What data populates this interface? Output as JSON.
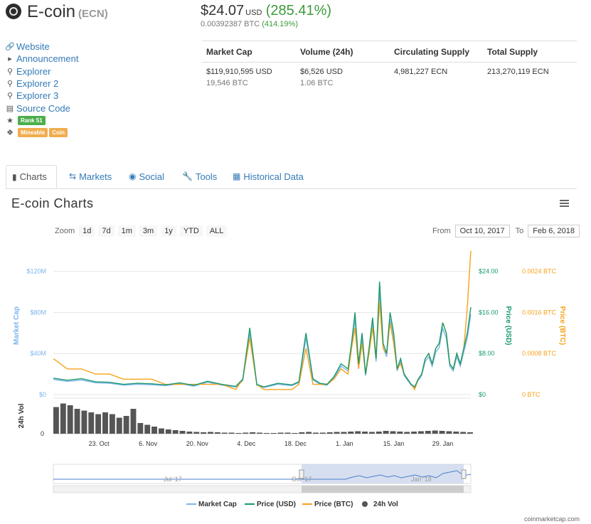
{
  "coin": {
    "name": "E-coin",
    "symbol": "(ECN)"
  },
  "price": {
    "usd": "$24.07",
    "unit": "USD",
    "usd_change": "(285.41%)",
    "btc": "0.00392387 BTC",
    "btc_change": "(414.19%)"
  },
  "links": [
    {
      "icon": "link-icon",
      "label": "Website"
    },
    {
      "icon": "bullhorn-icon",
      "label": "Announcement"
    },
    {
      "icon": "search-icon",
      "label": "Explorer"
    },
    {
      "icon": "search-icon",
      "label": "Explorer 2"
    },
    {
      "icon": "search-icon",
      "label": "Explorer 3"
    },
    {
      "icon": "hdd-icon",
      "label": "Source Code"
    }
  ],
  "rank": {
    "icon": "star-icon",
    "label": "Rank 51"
  },
  "tags": {
    "icon": "tags-icon",
    "items": [
      "Mineable",
      "Coin"
    ]
  },
  "stats": {
    "headers": [
      "Market Cap",
      "Volume (24h)",
      "Circulating Supply",
      "Total Supply"
    ],
    "row1": [
      "$119,910,595 USD",
      "$6,526 USD",
      "4,981,227 ECN",
      "213,270,119 ECN"
    ],
    "row2": [
      "19,546 BTC",
      "1.06 BTC",
      "",
      ""
    ]
  },
  "tabs": [
    {
      "icon": "bar-chart-icon",
      "label": "Charts"
    },
    {
      "icon": "exchange-icon",
      "label": "Markets"
    },
    {
      "icon": "globe-icon",
      "label": "Social"
    },
    {
      "icon": "wrench-icon",
      "label": "Tools"
    },
    {
      "icon": "calendar-icon",
      "label": "Historical Data"
    }
  ],
  "chart_header": {
    "title": "E-coin Charts"
  },
  "zoom": {
    "label": "Zoom",
    "buttons": [
      "1d",
      "7d",
      "1m",
      "3m",
      "1y",
      "YTD",
      "ALL"
    ]
  },
  "range": {
    "from_label": "From",
    "from": "Oct 10, 2017",
    "to_label": "To",
    "to": "Feb 6, 2018"
  },
  "credit": "coinmarketcap.com",
  "colors": {
    "market_cap": "#7cb5ec",
    "price_usd": "#1a9a6c",
    "price_btc": "#f7a21b",
    "volume": "#555555",
    "link": "#337ab7"
  },
  "chart_data": {
    "type": "line",
    "xlabels": [
      "23. Oct",
      "6. Nov",
      "20. Nov",
      "4. Dec",
      "18. Dec",
      "1. Jan",
      "15. Jan",
      "29. Jan"
    ],
    "axes": {
      "market_cap": {
        "label": "Market Cap",
        "ticks": [
          "$0",
          "$40M",
          "$80M",
          "$120M"
        ]
      },
      "price_usd": {
        "label": "Price (USD)",
        "ticks": [
          "$0",
          "$8.00",
          "$16.00",
          "$24.00"
        ]
      },
      "price_btc": {
        "label": "Price (BTC)",
        "ticks": [
          "0 BTC",
          "0.0008 BTC",
          "0.0016 BTC",
          "0.0024 BTC"
        ]
      },
      "volume": {
        "label": "24h Vol",
        "ticks": [
          "0"
        ]
      }
    },
    "navigator_labels": [
      "Jul '17",
      "Oct '17",
      "Jan '18"
    ],
    "legend": [
      "Market Cap",
      "Price (USD)",
      "Price (BTC)",
      "24h Vol"
    ],
    "series": [
      {
        "name": "Price (USD)",
        "x_days": [
          0,
          4,
          8,
          12,
          16,
          20,
          24,
          28,
          32,
          36,
          40,
          44,
          48,
          52,
          54,
          56,
          58,
          60,
          64,
          68,
          70,
          72,
          74,
          76,
          78,
          80,
          82,
          84,
          85,
          86,
          87,
          88,
          89,
          90,
          91,
          92,
          93,
          94,
          95,
          96,
          97,
          98,
          99,
          100,
          101,
          102,
          103,
          104,
          105,
          106,
          107,
          108,
          109,
          110,
          111,
          112,
          113,
          114,
          115,
          116,
          117,
          118,
          119
        ],
        "values": [
          3.2,
          2.8,
          3.1,
          2.5,
          2.4,
          2.0,
          2.2,
          2.1,
          1.9,
          2.3,
          1.8,
          2.6,
          2.0,
          1.6,
          3.0,
          13.0,
          2.0,
          1.5,
          2.2,
          1.9,
          2.5,
          12.0,
          3.1,
          2.2,
          2.0,
          3.5,
          6.0,
          5.0,
          10.0,
          16.0,
          6.0,
          12.0,
          4.0,
          9.0,
          15.0,
          7.0,
          22.0,
          10.0,
          8.0,
          16.0,
          12.0,
          5.0,
          7.0,
          4.0,
          3.0,
          2.0,
          1.5,
          3.0,
          4.0,
          7.0,
          8.0,
          6.0,
          9.0,
          10.0,
          14.0,
          12.0,
          6.0,
          5.0,
          8.0,
          6.0,
          9.0,
          12.0,
          17.0
        ]
      },
      {
        "name": "Price (BTC)",
        "x_days": [
          0,
          4,
          8,
          12,
          16,
          20,
          24,
          28,
          32,
          36,
          40,
          44,
          48,
          52,
          54,
          56,
          58,
          60,
          64,
          68,
          70,
          72,
          74,
          76,
          78,
          80,
          82,
          84,
          85,
          86,
          87,
          88,
          89,
          90,
          91,
          92,
          93,
          94,
          95,
          96,
          97,
          98,
          99,
          100,
          101,
          102,
          103,
          104,
          105,
          106,
          107,
          108,
          109,
          110,
          111,
          112,
          113,
          114,
          115,
          116,
          117,
          118,
          119
        ],
        "values": [
          0.0007,
          0.0005,
          0.0005,
          0.0004,
          0.0004,
          0.0003,
          0.0003,
          0.0003,
          0.0002,
          0.0002,
          0.0002,
          0.0002,
          0.0002,
          0.0001,
          0.0003,
          0.0011,
          0.0002,
          0.0001,
          0.0001,
          0.0001,
          0.0002,
          0.0009,
          0.0002,
          0.0002,
          0.0002,
          0.0003,
          0.0005,
          0.0004,
          0.0009,
          0.0013,
          0.0005,
          0.001,
          0.0004,
          0.0008,
          0.0013,
          0.0007,
          0.0018,
          0.0009,
          0.0008,
          0.0014,
          0.001,
          0.0005,
          0.0006,
          0.0004,
          0.0003,
          0.0002,
          0.0001,
          0.0003,
          0.0004,
          0.0007,
          0.0008,
          0.0006,
          0.0009,
          0.001,
          0.0014,
          0.0012,
          0.0006,
          0.0005,
          0.0008,
          0.0006,
          0.0009,
          0.0017,
          0.0028
        ]
      },
      {
        "name": "24h Vol",
        "x_days": [
          0,
          2,
          4,
          6,
          8,
          10,
          12,
          14,
          16,
          18,
          20,
          22,
          24,
          26,
          28,
          30,
          32,
          34,
          36,
          38,
          40,
          42,
          44,
          46,
          48,
          50,
          52,
          54,
          56,
          58,
          60,
          62,
          64,
          66,
          68,
          70,
          72,
          74,
          76,
          78,
          80,
          82,
          84,
          86,
          88,
          90,
          92,
          94,
          96,
          98,
          100,
          102,
          104,
          106,
          108,
          110,
          112,
          114,
          116,
          118
        ],
        "values": [
          0.75,
          0.85,
          0.8,
          0.7,
          0.65,
          0.6,
          0.55,
          0.6,
          0.55,
          0.45,
          0.5,
          0.7,
          0.3,
          0.25,
          0.2,
          0.15,
          0.12,
          0.1,
          0.08,
          0.06,
          0.05,
          0.04,
          0.05,
          0.04,
          0.03,
          0.03,
          0.02,
          0.03,
          0.04,
          0.03,
          0.02,
          0.02,
          0.03,
          0.03,
          0.02,
          0.04,
          0.05,
          0.03,
          0.03,
          0.04,
          0.05,
          0.05,
          0.06,
          0.07,
          0.06,
          0.05,
          0.06,
          0.08,
          0.07,
          0.06,
          0.05,
          0.06,
          0.07,
          0.08,
          0.09,
          0.08,
          0.07,
          0.06,
          0.05,
          0.04
        ]
      }
    ]
  }
}
